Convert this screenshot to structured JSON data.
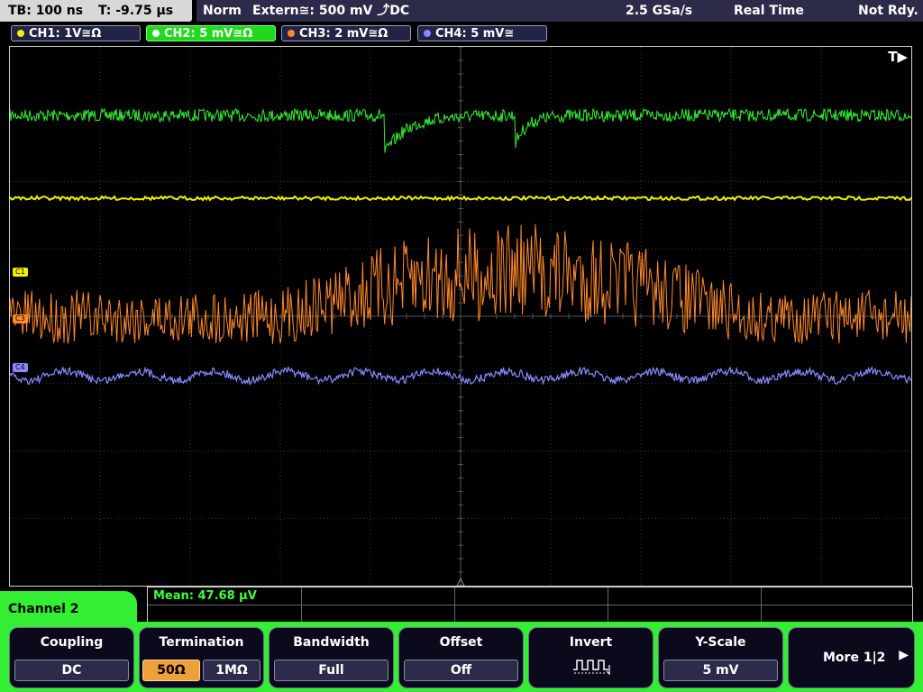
{
  "top": {
    "timebase": "TB: 100 ns",
    "trigger_time": "T: -9.75 µs",
    "mode": "Norm",
    "trigger_source": "Extern≅: 500 mV ⤴DC",
    "sample_rate": "2.5 GSa/s",
    "acq_mode": "Real Time",
    "status": "Not Rdy."
  },
  "channels": [
    {
      "label": "CH1: 1V≅Ω",
      "color": "#f0f000"
    },
    {
      "label": "CH2: 5 mV≅Ω",
      "color": "#33ee33"
    },
    {
      "label": "CH3: 2 mV≅Ω",
      "color": "#ff8a2a"
    },
    {
      "label": "CH4: 5 mV≅",
      "color": "#8a8aff"
    }
  ],
  "markers": {
    "c1": "C1",
    "c3": "C3",
    "c4": "C4",
    "trigger": "T▶"
  },
  "measurement": {
    "label": "Mean: 47.68 µV"
  },
  "menu": {
    "title": "Channel 2",
    "coupling": {
      "title": "Coupling",
      "value": "DC"
    },
    "termination": {
      "title": "Termination",
      "opt1": "50Ω",
      "opt2": "1MΩ"
    },
    "bandwidth": {
      "title": "Bandwidth",
      "value": "Full"
    },
    "offset": {
      "title": "Offset",
      "value": "Off"
    },
    "invert": {
      "title": "Invert"
    },
    "yscale": {
      "title": "Y-Scale",
      "value": "5 mV"
    },
    "more": "More 1|2"
  }
}
